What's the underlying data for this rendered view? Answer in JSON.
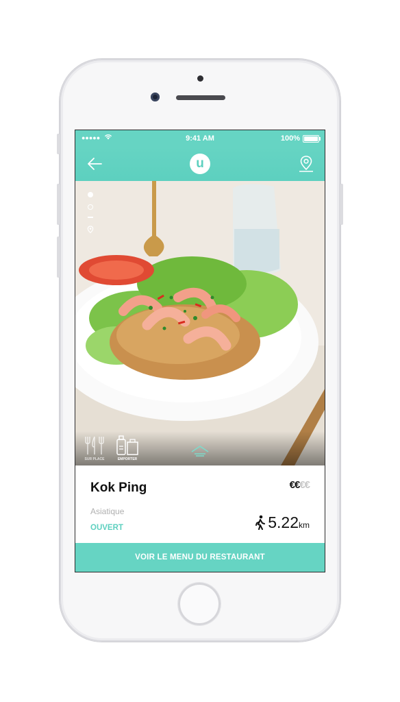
{
  "status_bar": {
    "signal": "●●●●●",
    "time": "9:41 AM",
    "battery": "100%"
  },
  "nav": {
    "logo": "u",
    "icons": [
      "back-arrow-icon",
      "map-pin-icon"
    ]
  },
  "gallery": {
    "slides": 2,
    "active_index": 0
  },
  "services": [
    {
      "label": "SUR PLACE",
      "icon": "fork-knife-icon",
      "active": false
    },
    {
      "label": "EMPORTER",
      "icon": "takeaway-bag-icon",
      "active": true
    }
  ],
  "restaurant": {
    "name": "Kok Ping",
    "price": {
      "active": "€€",
      "inactive": "€€"
    },
    "cuisine": "Asiatique",
    "status": "OUVERT",
    "distance": "5.22",
    "distance_unit": "km"
  },
  "cta": {
    "label": "VOIR LE MENU DU RESTAURANT"
  },
  "colors": {
    "accent": "#5dd0bf",
    "text": "#111111",
    "muted": "#b0b0b0"
  }
}
